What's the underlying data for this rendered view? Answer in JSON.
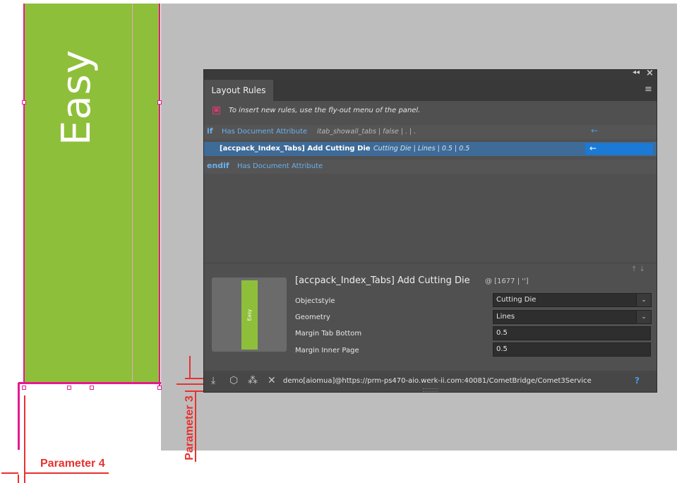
{
  "document": {
    "tab_text": "Easy"
  },
  "annotations": {
    "parameter3_label": "Parameter 3",
    "parameter4_label": "Parameter 4"
  },
  "panel": {
    "title": "Layout Rules",
    "hint": "To insert new rules, use the fly-out menu of the panel.",
    "rules": {
      "if_keyword": "if",
      "if_condition": "Has Document Attribute",
      "if_args": "itab_showall_tabs | false | . | .",
      "main_name": "[accpack_Index_Tabs] Add Cutting Die",
      "main_args": "Cutting Die | Lines | 0.5 | 0.5",
      "endif_keyword": "endif",
      "endif_condition": "Has Document Attribute"
    },
    "detail": {
      "title": "[accpack_Index_Tabs] Add Cutting Die",
      "location": "@ [1677 | '']",
      "preview_text": "Easy",
      "params": [
        {
          "label": "Objectstyle",
          "value": "Cutting Die"
        },
        {
          "label": "Geometry",
          "value": "Lines"
        },
        {
          "label": "Margin Tab Bottom",
          "value": "0.5"
        },
        {
          "label": "Margin Inner Page",
          "value": "0.5"
        }
      ]
    },
    "footer": {
      "status": "demo[aiomua]@https://prm-ps470-aio.werk-ii.com:40081/CometBridge/Comet3Service",
      "help": "?"
    }
  },
  "colors": {
    "tab_green": "#8ebf3a",
    "frame_magenta": "#e6198c",
    "dimension_red": "#e8312f",
    "selection_blue": "#3e6b98",
    "keyword_blue": "#6ab1f1"
  }
}
